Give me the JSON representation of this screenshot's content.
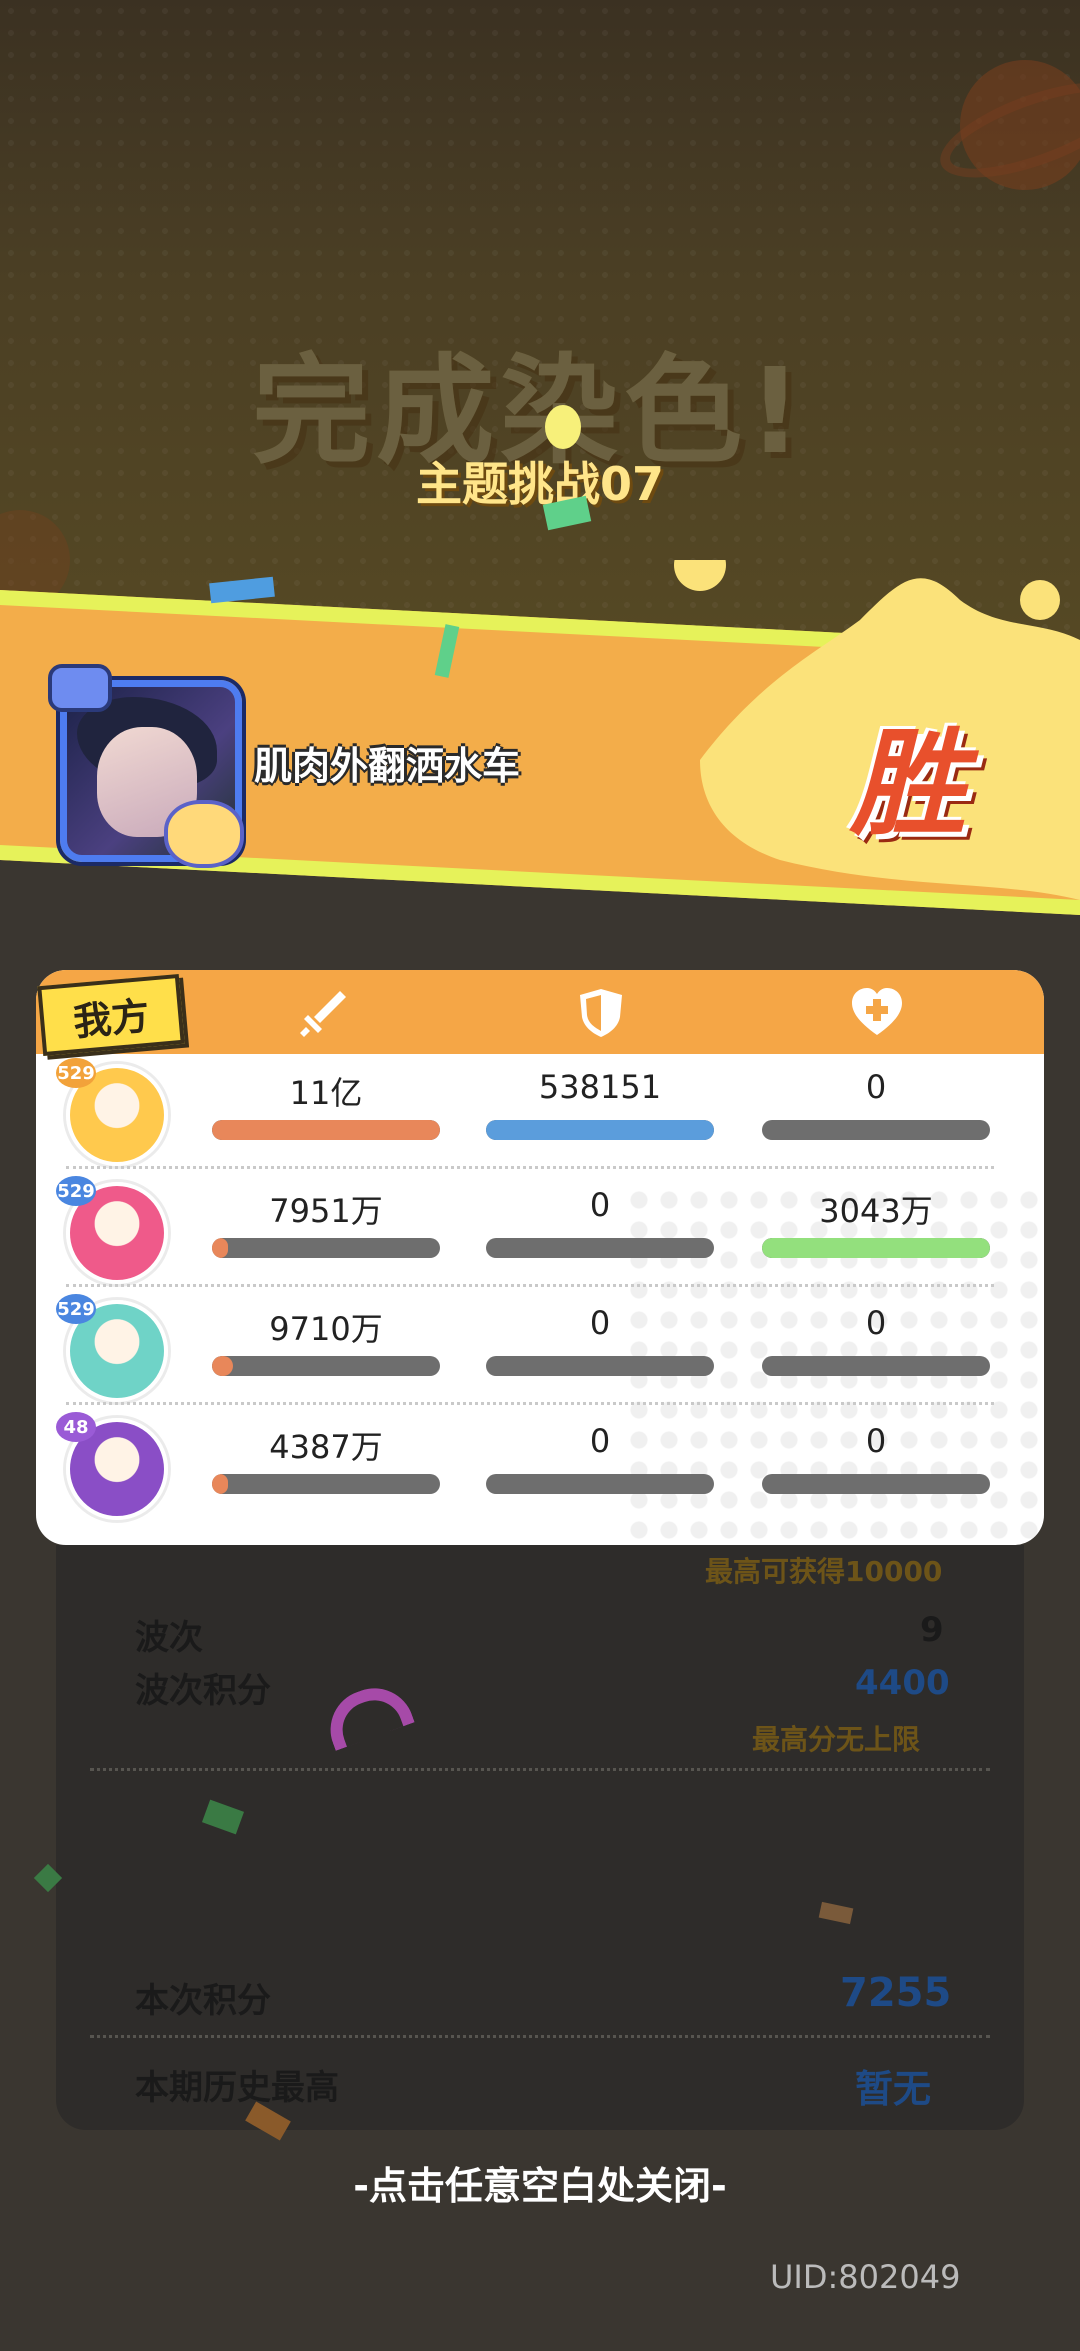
{
  "title": "完成染色!",
  "subtitle": "主题挑战07",
  "player": {
    "name": "肌肉外翻洒水车",
    "avatar_icon": "player-avatar",
    "result": "胜"
  },
  "team_label": "我方",
  "columns": [
    {
      "icon": "sword-icon"
    },
    {
      "icon": "shield-icon"
    },
    {
      "icon": "heart-plus-icon"
    }
  ],
  "rows": [
    {
      "level": "529",
      "avatar_color": "#ffc94d",
      "damage": "11亿",
      "damage_fill": 1.0,
      "defense": "538151",
      "defense_fill": 1.0,
      "heal": "0",
      "heal_fill": 0.0
    },
    {
      "level": "529",
      "avatar_color": "#ef5a8a",
      "damage": "7951万",
      "damage_fill": 0.07,
      "defense": "0",
      "defense_fill": 0.0,
      "heal": "3043万",
      "heal_fill": 1.0
    },
    {
      "level": "529",
      "avatar_color": "#6fd3c7",
      "damage": "9710万",
      "damage_fill": 0.09,
      "defense": "0",
      "defense_fill": 0.0,
      "heal": "0",
      "heal_fill": 0.0
    },
    {
      "level": "48",
      "avatar_color": "#8a4ec6",
      "damage": "4387万",
      "damage_fill": 0.04,
      "defense": "0",
      "defense_fill": 0.0,
      "heal": "0",
      "heal_fill": 0.0
    }
  ],
  "colors": {
    "damage": "#e8875a",
    "defense": "#5b9ddc",
    "heal": "#93e07d",
    "empty": "#6e6e6e",
    "accent": "#f5a646"
  },
  "summary": {
    "max_obtainable": "最高可获得10000",
    "waves_label": "波次",
    "waves_value": "9",
    "wave_score_label": "波次积分",
    "wave_score_value": "4400",
    "no_limit_note": "最高分无上限",
    "score_label": "本次积分",
    "score_value": "7255",
    "best_label": "本期历史最高",
    "best_value": "暂无"
  },
  "close_hint": "-点击任意空白处关闭-",
  "uid": "UID:802049"
}
